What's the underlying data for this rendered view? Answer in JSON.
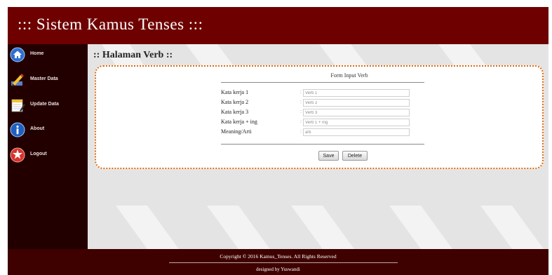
{
  "header": {
    "title": "::: Sistem Kamus Tenses :::"
  },
  "sidebar": {
    "items": [
      {
        "label": "Home",
        "icon": "home-icon"
      },
      {
        "label": "Master Data",
        "icon": "pencil-edit-icon"
      },
      {
        "label": "Update Data",
        "icon": "notepad-icon"
      },
      {
        "label": "About",
        "icon": "info-icon"
      },
      {
        "label": "Logout",
        "icon": "logout-icon"
      }
    ]
  },
  "main": {
    "heading": ":: Halaman Verb ::",
    "form": {
      "title": "Form Input Verb",
      "fields": [
        {
          "label": "Kata kerja 1",
          "colon": ":",
          "placeholder": "Verb 1",
          "value": ""
        },
        {
          "label": "Kata kerja 2",
          "colon": ":",
          "placeholder": "Verb 2",
          "value": ""
        },
        {
          "label": "Kata kerja 3",
          "colon": ":",
          "placeholder": "Verb 3",
          "value": ""
        },
        {
          "label": "Kata kerja + ing",
          "colon": ":",
          "placeholder": "Verb 1 + ing",
          "value": ""
        },
        {
          "label": "Meaning/Arti",
          "colon": ":",
          "placeholder": "arti",
          "value": ""
        }
      ],
      "save_label": "Save",
      "delete_label": "Delete"
    }
  },
  "footer": {
    "copyright": "Copyright © 2016 Kamus_Tenses. All Rights Reserved",
    "credit": "designed by Yuswandi"
  },
  "colors": {
    "header": "#6e0000",
    "sidebar": "#230000",
    "footer": "#3f0000",
    "card_border": "#e06a0c"
  }
}
